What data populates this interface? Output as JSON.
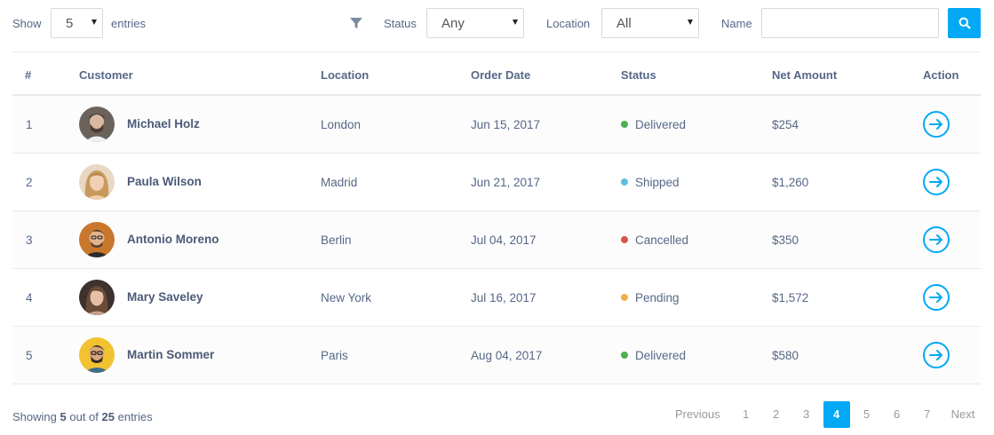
{
  "filters": {
    "show_label": "Show",
    "show_value": "5",
    "entries_label": "entries",
    "status_label": "Status",
    "status_value": "Any",
    "location_label": "Location",
    "location_value": "All",
    "name_label": "Name",
    "name_value": ""
  },
  "table": {
    "headers": [
      "#",
      "Customer",
      "Location",
      "Order Date",
      "Status",
      "Net Amount",
      "Action"
    ],
    "rows": [
      {
        "num": "1",
        "customer": "Michael Holz",
        "location": "London",
        "date": "Jun 15, 2017",
        "status": "Delivered",
        "status_color": "#4caf50",
        "amount": "$254"
      },
      {
        "num": "2",
        "customer": "Paula Wilson",
        "location": "Madrid",
        "date": "Jun 21, 2017",
        "status": "Shipped",
        "status_color": "#5bc0de",
        "amount": "$1,260"
      },
      {
        "num": "3",
        "customer": "Antonio Moreno",
        "location": "Berlin",
        "date": "Jul 04, 2017",
        "status": "Cancelled",
        "status_color": "#d9534f",
        "amount": "$350"
      },
      {
        "num": "4",
        "customer": "Mary Saveley",
        "location": "New York",
        "date": "Jul 16, 2017",
        "status": "Pending",
        "status_color": "#f0ad4e",
        "amount": "$1,572"
      },
      {
        "num": "5",
        "customer": "Martin Sommer",
        "location": "Paris",
        "date": "Aug 04, 2017",
        "status": "Delivered",
        "status_color": "#4caf50",
        "amount": "$580"
      }
    ]
  },
  "footer": {
    "showing_prefix": "Showing",
    "showing_count": "5",
    "showing_middle": "out of",
    "showing_total": "25",
    "showing_suffix": "entries"
  },
  "pagination": {
    "prev": "Previous",
    "next": "Next",
    "pages": [
      "1",
      "2",
      "3",
      "4",
      "5",
      "6",
      "7"
    ],
    "active": "4"
  },
  "colors": {
    "accent": "#03a9f4",
    "text": "#566787",
    "border": "#e9e9e9"
  }
}
